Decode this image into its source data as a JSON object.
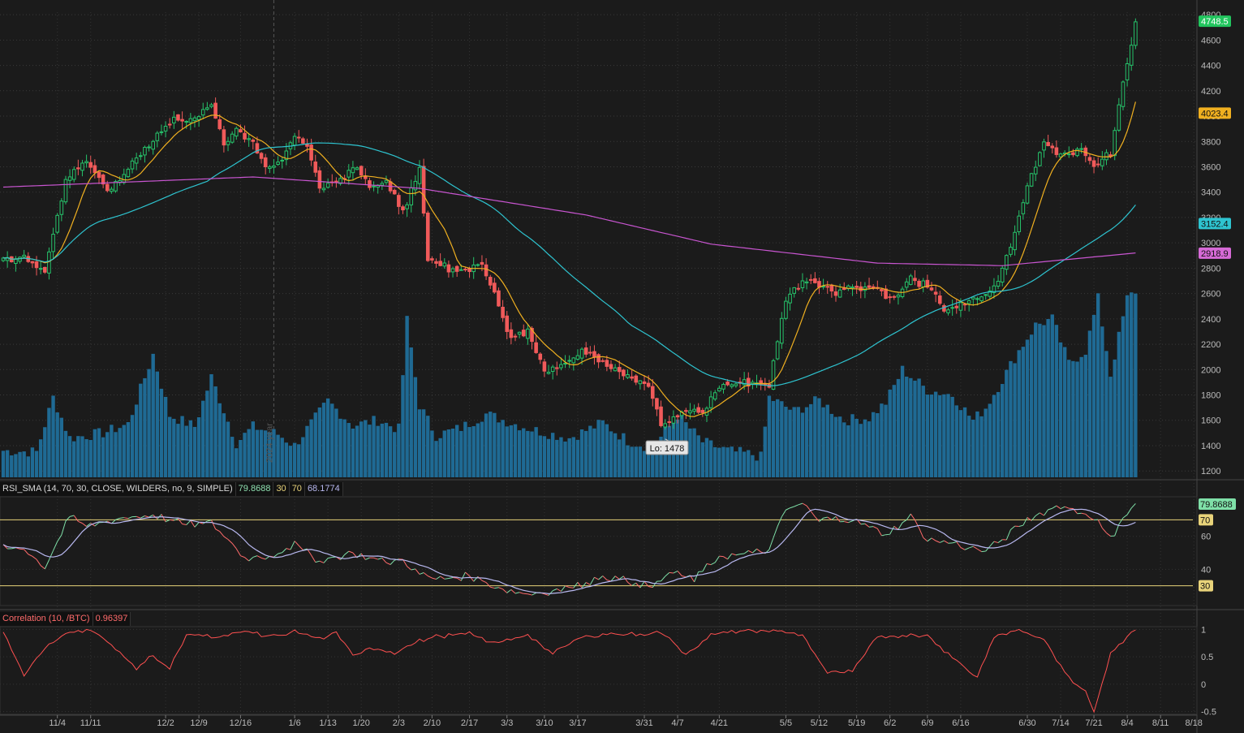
{
  "chart_data": [
    {
      "type": "candlestick",
      "panel": "price",
      "ylim": [
        1150,
        4820
      ],
      "y_ticks": [
        1200,
        1400,
        1600,
        1800,
        2000,
        2200,
        2400,
        2600,
        2800,
        3000,
        3200,
        3400,
        3600,
        3800,
        4000,
        4200,
        4400,
        4600,
        4800
      ],
      "x_ticks": [
        "11/4",
        "11/11",
        "12/2",
        "12/9",
        "12/16",
        "1/6",
        "1/13",
        "1/20",
        "2/3",
        "2/10",
        "2/17",
        "3/3",
        "3/10",
        "3/17",
        "3/31",
        "4/7",
        "4/21",
        "5/5",
        "5/12",
        "5/19",
        "6/2",
        "6/9",
        "6/16",
        "6/30",
        "7/14",
        "7/21",
        "8/4",
        "8/11",
        "8/18"
      ],
      "watermark": "2024 year",
      "low_label": "Lo: 1478",
      "close_anchors": [
        [
          0,
          2880
        ],
        [
          5,
          2870
        ],
        [
          10,
          2780
        ],
        [
          15,
          3500
        ],
        [
          20,
          3640
        ],
        [
          25,
          3420
        ],
        [
          30,
          3580
        ],
        [
          35,
          3760
        ],
        [
          40,
          3960
        ],
        [
          45,
          3980
        ],
        [
          50,
          4100
        ],
        [
          53,
          3750
        ],
        [
          56,
          3900
        ],
        [
          60,
          3800
        ],
        [
          63,
          3600
        ],
        [
          67,
          3650
        ],
        [
          70,
          3860
        ],
        [
          73,
          3750
        ],
        [
          76,
          3460
        ],
        [
          80,
          3480
        ],
        [
          85,
          3620
        ],
        [
          88,
          3450
        ],
        [
          92,
          3460
        ],
        [
          96,
          3260
        ],
        [
          100,
          3560
        ],
        [
          102,
          2860
        ],
        [
          105,
          2820
        ],
        [
          110,
          2780
        ],
        [
          115,
          2840
        ],
        [
          118,
          2580
        ],
        [
          122,
          2240
        ],
        [
          126,
          2320
        ],
        [
          130,
          2000
        ],
        [
          135,
          2050
        ],
        [
          140,
          2150
        ],
        [
          145,
          2050
        ],
        [
          150,
          1960
        ],
        [
          155,
          1880
        ],
        [
          158,
          1560
        ],
        [
          161,
          1600
        ],
        [
          164,
          1680
        ],
        [
          168,
          1660
        ],
        [
          172,
          1870
        ],
        [
          176,
          1890
        ],
        [
          180,
          1900
        ],
        [
          184,
          1880
        ],
        [
          188,
          2560
        ],
        [
          192,
          2700
        ],
        [
          196,
          2680
        ],
        [
          200,
          2620
        ],
        [
          205,
          2660
        ],
        [
          210,
          2640
        ],
        [
          214,
          2550
        ],
        [
          218,
          2720
        ],
        [
          222,
          2650
        ],
        [
          226,
          2480
        ],
        [
          230,
          2500
        ],
        [
          234,
          2560
        ],
        [
          238,
          2640
        ],
        [
          242,
          2960
        ],
        [
          246,
          3450
        ],
        [
          250,
          3800
        ],
        [
          254,
          3700
        ],
        [
          258,
          3740
        ],
        [
          262,
          3620
        ],
        [
          266,
          3700
        ],
        [
          269,
          4260
        ],
        [
          272,
          4720
        ]
      ],
      "volume_anchors": [
        [
          0,
          1360
        ],
        [
          8,
          1350
        ],
        [
          12,
          1780
        ],
        [
          16,
          1460
        ],
        [
          24,
          1500
        ],
        [
          30,
          1570
        ],
        [
          36,
          2120
        ],
        [
          40,
          1640
        ],
        [
          46,
          1550
        ],
        [
          50,
          1940
        ],
        [
          56,
          1420
        ],
        [
          60,
          1550
        ],
        [
          66,
          1490
        ],
        [
          70,
          1400
        ],
        [
          78,
          1750
        ],
        [
          84,
          1560
        ],
        [
          90,
          1600
        ],
        [
          95,
          1530
        ],
        [
          97,
          2390
        ],
        [
          100,
          1720
        ],
        [
          104,
          1480
        ],
        [
          110,
          1540
        ],
        [
          116,
          1650
        ],
        [
          122,
          1580
        ],
        [
          128,
          1520
        ],
        [
          136,
          1460
        ],
        [
          144,
          1580
        ],
        [
          150,
          1440
        ],
        [
          156,
          1380
        ],
        [
          162,
          1640
        ],
        [
          168,
          1430
        ],
        [
          174,
          1360
        ],
        [
          180,
          1330
        ],
        [
          182,
          1310
        ],
        [
          184,
          1780
        ],
        [
          190,
          1670
        ],
        [
          196,
          1760
        ],
        [
          202,
          1600
        ],
        [
          208,
          1620
        ],
        [
          212,
          1740
        ],
        [
          216,
          2000
        ],
        [
          222,
          1840
        ],
        [
          228,
          1800
        ],
        [
          233,
          1600
        ],
        [
          236,
          1700
        ],
        [
          240,
          1920
        ],
        [
          244,
          2150
        ],
        [
          248,
          2350
        ],
        [
          252,
          2400
        ],
        [
          256,
          2050
        ],
        [
          260,
          2150
        ],
        [
          263,
          2560
        ],
        [
          266,
          1960
        ],
        [
          270,
          2560
        ],
        [
          272,
          2620
        ]
      ],
      "series": [
        {
          "name": "",
          "type": "ma",
          "color": "#f0b020",
          "last": "4023.4"
        },
        {
          "name": "",
          "type": "ma",
          "color": "#2ec4d0",
          "last": "3152.4"
        },
        {
          "name": "",
          "type": "ma",
          "color": "#c855d0",
          "last": "2918.9"
        }
      ],
      "last_price": "4748.5"
    },
    {
      "type": "line",
      "panel": "rsi",
      "ylim": [
        18,
        84
      ],
      "y_ticks": [
        40,
        60
      ],
      "levels": [
        30,
        70
      ],
      "anchors": [
        [
          0,
          55
        ],
        [
          6,
          51
        ],
        [
          10,
          41
        ],
        [
          16,
          72
        ],
        [
          20,
          66
        ],
        [
          28,
          71
        ],
        [
          36,
          73
        ],
        [
          44,
          67
        ],
        [
          50,
          68
        ],
        [
          54,
          58
        ],
        [
          58,
          47
        ],
        [
          64,
          48
        ],
        [
          70,
          55
        ],
        [
          76,
          45
        ],
        [
          84,
          50
        ],
        [
          92,
          44
        ],
        [
          96,
          46
        ],
        [
          100,
          37
        ],
        [
          104,
          34
        ],
        [
          112,
          36
        ],
        [
          120,
          28
        ],
        [
          126,
          25
        ],
        [
          132,
          27
        ],
        [
          138,
          30
        ],
        [
          144,
          36
        ],
        [
          150,
          33
        ],
        [
          156,
          29
        ],
        [
          160,
          38
        ],
        [
          166,
          34
        ],
        [
          172,
          48
        ],
        [
          178,
          49
        ],
        [
          184,
          52
        ],
        [
          188,
          76
        ],
        [
          192,
          80
        ],
        [
          196,
          69
        ],
        [
          200,
          72
        ],
        [
          206,
          68
        ],
        [
          212,
          61
        ],
        [
          218,
          72
        ],
        [
          222,
          58
        ],
        [
          228,
          56
        ],
        [
          232,
          53
        ],
        [
          236,
          51
        ],
        [
          240,
          58
        ],
        [
          246,
          70
        ],
        [
          250,
          75
        ],
        [
          254,
          79
        ],
        [
          258,
          75
        ],
        [
          262,
          72
        ],
        [
          266,
          58
        ],
        [
          269,
          72
        ],
        [
          272,
          79.87
        ]
      ],
      "rsi_label": "RSI_SMA (14, 70, 30, CLOSE, WILDERS, no, 9, SIMPLE)",
      "rsi_value": "79.8688",
      "oversold": "30",
      "overbought": "70",
      "avg_value": "68.1774",
      "colors": {
        "up": "#7fe0a8",
        "down": "#ff6b6b",
        "avg": "#b8b8f0",
        "level": "#e8d37a"
      }
    },
    {
      "type": "line",
      "panel": "correlation",
      "ylim": [
        -0.55,
        1.05
      ],
      "y_ticks": [
        1,
        0.5,
        0,
        -0.5
      ],
      "y_tick_labels": [
        "1",
        "0.5",
        "0",
        "-0.5"
      ],
      "anchors": [
        [
          0,
          0.95
        ],
        [
          5,
          0.16
        ],
        [
          10,
          0.65
        ],
        [
          16,
          0.98
        ],
        [
          22,
          0.98
        ],
        [
          28,
          0.56
        ],
        [
          32,
          0.3
        ],
        [
          36,
          0.52
        ],
        [
          40,
          0.28
        ],
        [
          44,
          0.92
        ],
        [
          52,
          0.84
        ],
        [
          58,
          0.97
        ],
        [
          64,
          0.86
        ],
        [
          70,
          0.96
        ],
        [
          76,
          0.83
        ],
        [
          80,
          0.92
        ],
        [
          84,
          0.53
        ],
        [
          88,
          0.67
        ],
        [
          94,
          0.58
        ],
        [
          100,
          0.79
        ],
        [
          104,
          0.87
        ],
        [
          112,
          0.92
        ],
        [
          118,
          0.74
        ],
        [
          126,
          0.91
        ],
        [
          132,
          0.55
        ],
        [
          138,
          0.83
        ],
        [
          144,
          0.92
        ],
        [
          152,
          0.91
        ],
        [
          158,
          0.95
        ],
        [
          164,
          0.55
        ],
        [
          170,
          0.9
        ],
        [
          178,
          0.98
        ],
        [
          186,
          0.97
        ],
        [
          192,
          0.9
        ],
        [
          198,
          0.2
        ],
        [
          204,
          0.23
        ],
        [
          210,
          0.86
        ],
        [
          216,
          0.89
        ],
        [
          222,
          0.9
        ],
        [
          228,
          0.48
        ],
        [
          234,
          0.13
        ],
        [
          238,
          0.88
        ],
        [
          244,
          0.99
        ],
        [
          250,
          0.82
        ],
        [
          256,
          0.1
        ],
        [
          260,
          -0.14
        ],
        [
          262,
          -0.5
        ],
        [
          266,
          0.55
        ],
        [
          270,
          0.87
        ],
        [
          272,
          0.96
        ]
      ],
      "label": "Correlation (10, /BTC)",
      "value": "0.96397",
      "color": "#ff5050"
    }
  ]
}
